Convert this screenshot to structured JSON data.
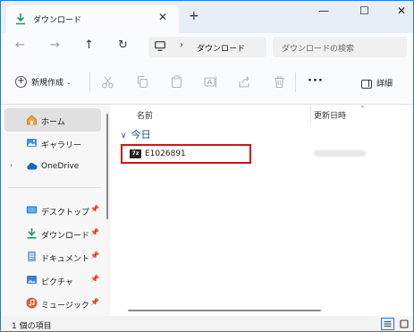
{
  "tab": {
    "title": "ダウンロード",
    "close_glyph": "✕",
    "new_tab_glyph": "+"
  },
  "window_controls": {
    "minimize": "—",
    "maximize": "☐",
    "close": "✕"
  },
  "nav": {
    "back": "←",
    "forward": "→",
    "up": "↑",
    "refresh": "↻"
  },
  "address": {
    "chevron": "›",
    "crumb": "ダウンロード"
  },
  "search": {
    "placeholder": "ダウンロードの検索"
  },
  "commands": {
    "new_label": "新規作成",
    "new_plus": "+",
    "new_caret": "⌄",
    "more": "···",
    "details_label": "詳細"
  },
  "sidebar": {
    "items": [
      {
        "label": "ホーム",
        "icon": "home-icon",
        "selected": true
      },
      {
        "label": "ギャラリー",
        "icon": "gallery-icon"
      },
      {
        "label": "OneDrive",
        "icon": "cloud-icon",
        "expand": "›"
      },
      {
        "label": "デスクトップ",
        "icon": "desktop-icon",
        "pin": "📌"
      },
      {
        "label": "ダウンロード",
        "icon": "download-icon",
        "pin": "📌"
      },
      {
        "label": "ドキュメント",
        "icon": "document-icon",
        "pin": "📌"
      },
      {
        "label": "ピクチャ",
        "icon": "picture-icon",
        "pin": "📌"
      },
      {
        "label": "ミュージック",
        "icon": "music-icon",
        "pin": "📌"
      }
    ]
  },
  "content": {
    "columns": {
      "name": "名前",
      "modified": "更新日時",
      "sort_glyph": "⌃"
    },
    "group": {
      "caret": "∨",
      "label": "今日"
    },
    "files": [
      {
        "name": "E1026891",
        "icon_text": "7z"
      }
    ]
  },
  "status": {
    "text": "1 個の項目"
  },
  "colors": {
    "accent": "#1f7fd4",
    "highlight_border": "#d0141a",
    "group_text": "#1a4f8a",
    "download_green": "#1c9c6b"
  }
}
